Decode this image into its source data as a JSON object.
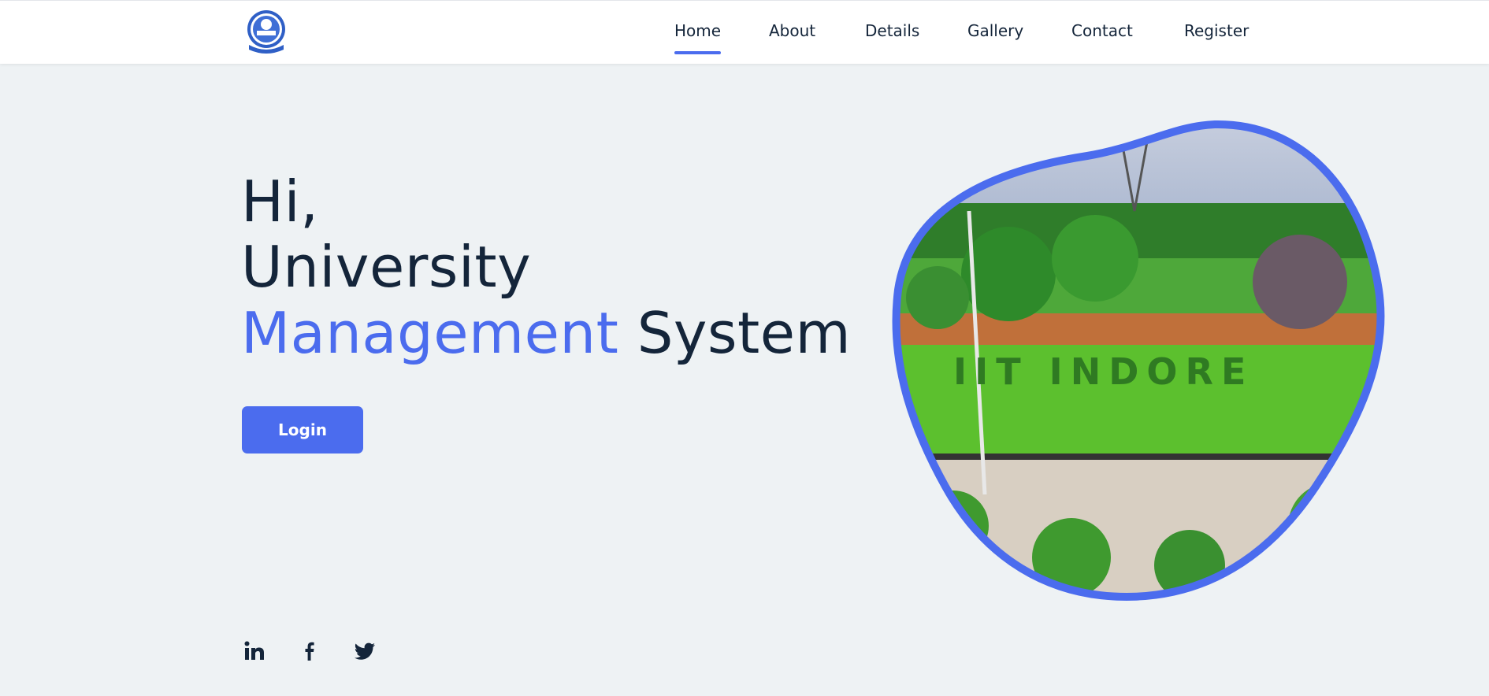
{
  "header": {
    "logo_icon": "university-seal-logo",
    "nav": [
      {
        "label": "Home",
        "active": true
      },
      {
        "label": "About",
        "active": false
      },
      {
        "label": "Details",
        "active": false
      },
      {
        "label": "Gallery",
        "active": false
      },
      {
        "label": "Contact",
        "active": false
      },
      {
        "label": "Register",
        "active": false
      }
    ]
  },
  "hero": {
    "greeting": "Hi,",
    "line2": "University",
    "line3_accent": "Management",
    "line3_rest": "System",
    "login_label": "Login",
    "image_text": "IIT INDORE"
  },
  "social": {
    "icons": [
      "linkedin-icon",
      "facebook-icon",
      "twitter-icon"
    ]
  },
  "colors": {
    "accent": "#4b6cee",
    "text": "#14253a",
    "background": "#eef2f4",
    "header": "#ffffff"
  }
}
